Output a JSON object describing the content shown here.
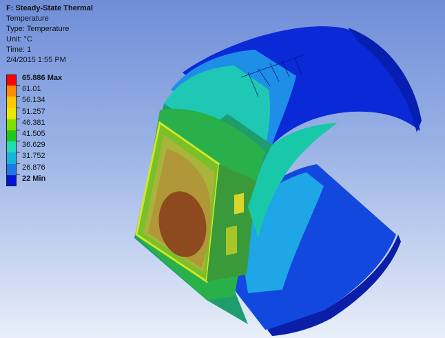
{
  "header": {
    "title": "F: Steady-State Thermal",
    "type_line": "Temperature",
    "result_type": "Type: Temperature",
    "unit": "Unit: °C",
    "time": "Time: 1",
    "timestamp": "2/4/2015 1:55 PM"
  },
  "legend": {
    "entries": [
      {
        "label": "65.886 Max",
        "color": "#ff0000",
        "bold": true
      },
      {
        "label": "61.01",
        "color": "#ff8c00",
        "bold": false
      },
      {
        "label": "56.134",
        "color": "#ffc800",
        "bold": false
      },
      {
        "label": "51.257",
        "color": "#e8e800",
        "bold": false
      },
      {
        "label": "46.381",
        "color": "#7fe000",
        "bold": false
      },
      {
        "label": "41.505",
        "color": "#1ec81e",
        "bold": false
      },
      {
        "label": "36.629",
        "color": "#1edcb4",
        "bold": false
      },
      {
        "label": "31.752",
        "color": "#14b4dc",
        "bold": false
      },
      {
        "label": "26.876",
        "color": "#1e78e6",
        "bold": false
      },
      {
        "label": "22 Min",
        "color": "#0014d2",
        "bold": true
      }
    ]
  },
  "colors": {
    "background_top": "#6f8ed8",
    "background_bottom": "#e8eef9",
    "model_cold": "#0a2ad8",
    "model_warm": "#b08a20"
  }
}
